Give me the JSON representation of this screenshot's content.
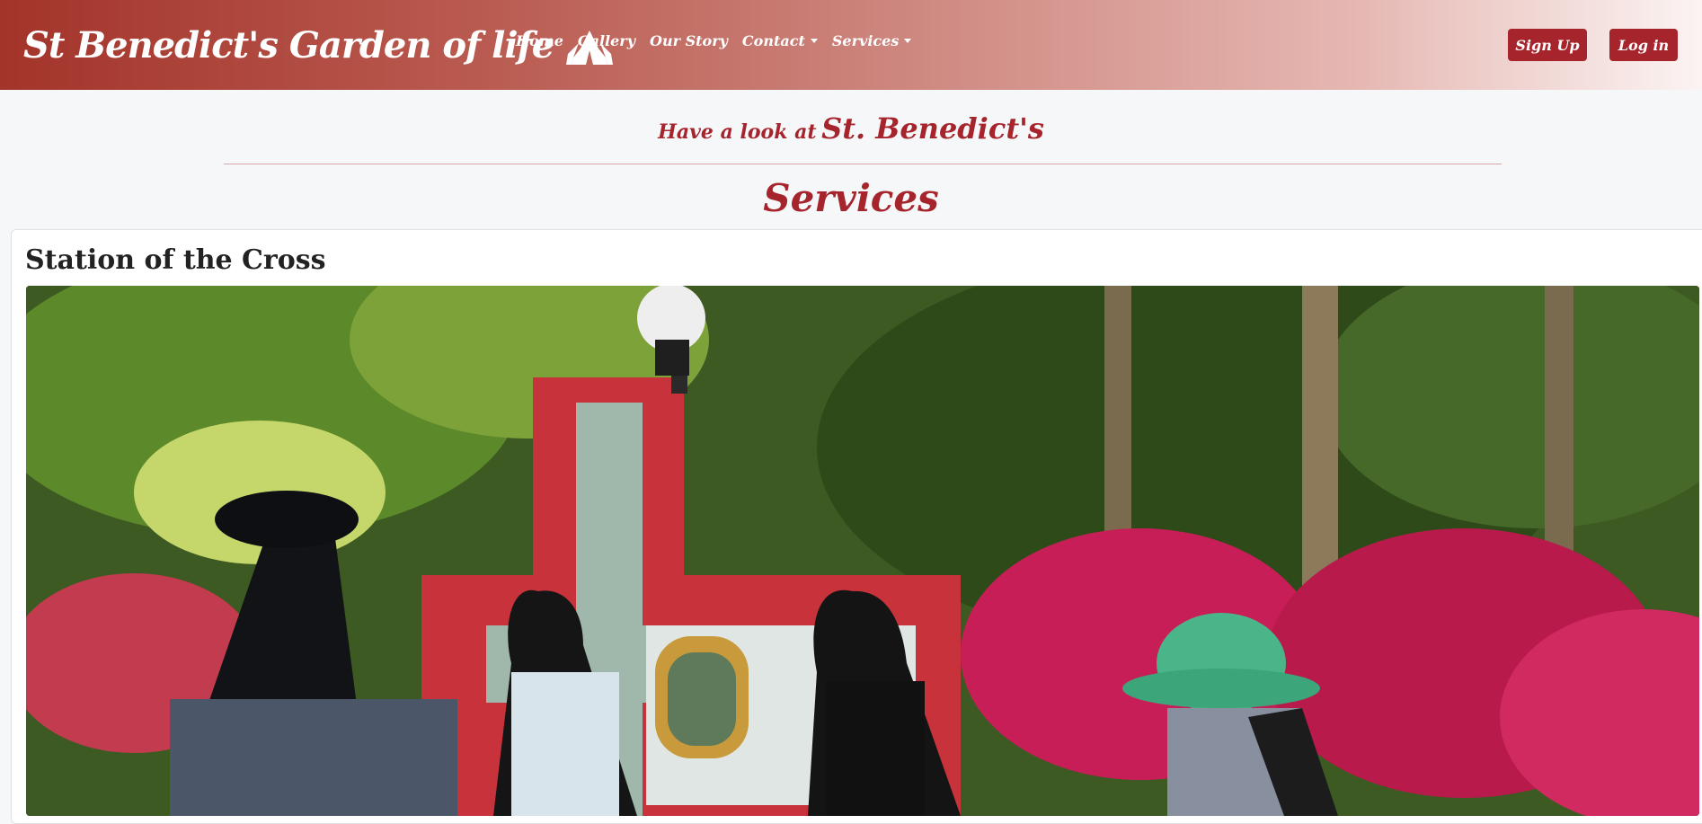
{
  "nav": {
    "brand": "St Benedict's Garden of life",
    "brand_icon": "praying-hands-icon",
    "links": [
      "Home",
      "Gallery",
      "Our Story",
      "Contact",
      "Services"
    ],
    "signup": "Sign Up",
    "login": "Log in"
  },
  "intro": {
    "lookat_small": "Have a look at",
    "lookat_big": "St. Benedict's",
    "title": "Services"
  },
  "card": {
    "title": "Station of the Cross"
  },
  "colors": {
    "accent": "#a6252d",
    "nav_start": "#a3342a",
    "nav_end": "#fbf4f3"
  }
}
